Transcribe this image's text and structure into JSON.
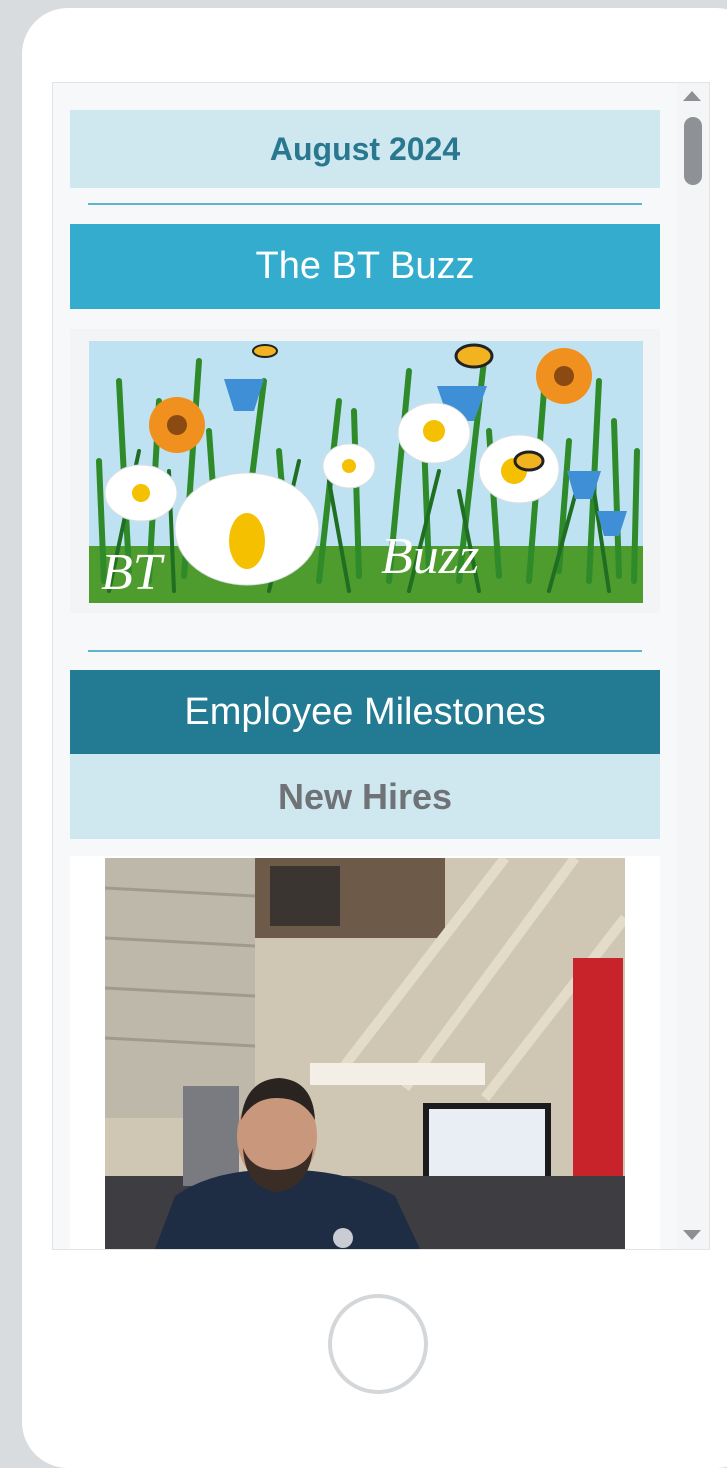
{
  "newsletter": {
    "date_heading": "August 2024",
    "title": "The BT Buzz",
    "banner": {
      "logo_text_left": "BT",
      "logo_text_right": "Buzz",
      "description": "Daisies, blue bellflowers and orange flowers in grass with bees"
    },
    "milestones_heading": "Employee Milestones",
    "new_hires_heading": "New Hires",
    "new_hire_photo": {
      "description": "Bearded man in navy uniform seated at a desk with a computer monitor in a workshop"
    }
  },
  "scrollbar": {
    "position_fraction": 0.0
  },
  "icons": [
    "scroll-up-arrow-icon",
    "scroll-down-arrow-icon",
    "home-button-icon"
  ],
  "colors": {
    "light_band": "#cfe8f0",
    "title_band": "#33acce",
    "milestones_band": "#237a93",
    "date_text": "#2a7890",
    "subheading_text": "#6f7276"
  }
}
